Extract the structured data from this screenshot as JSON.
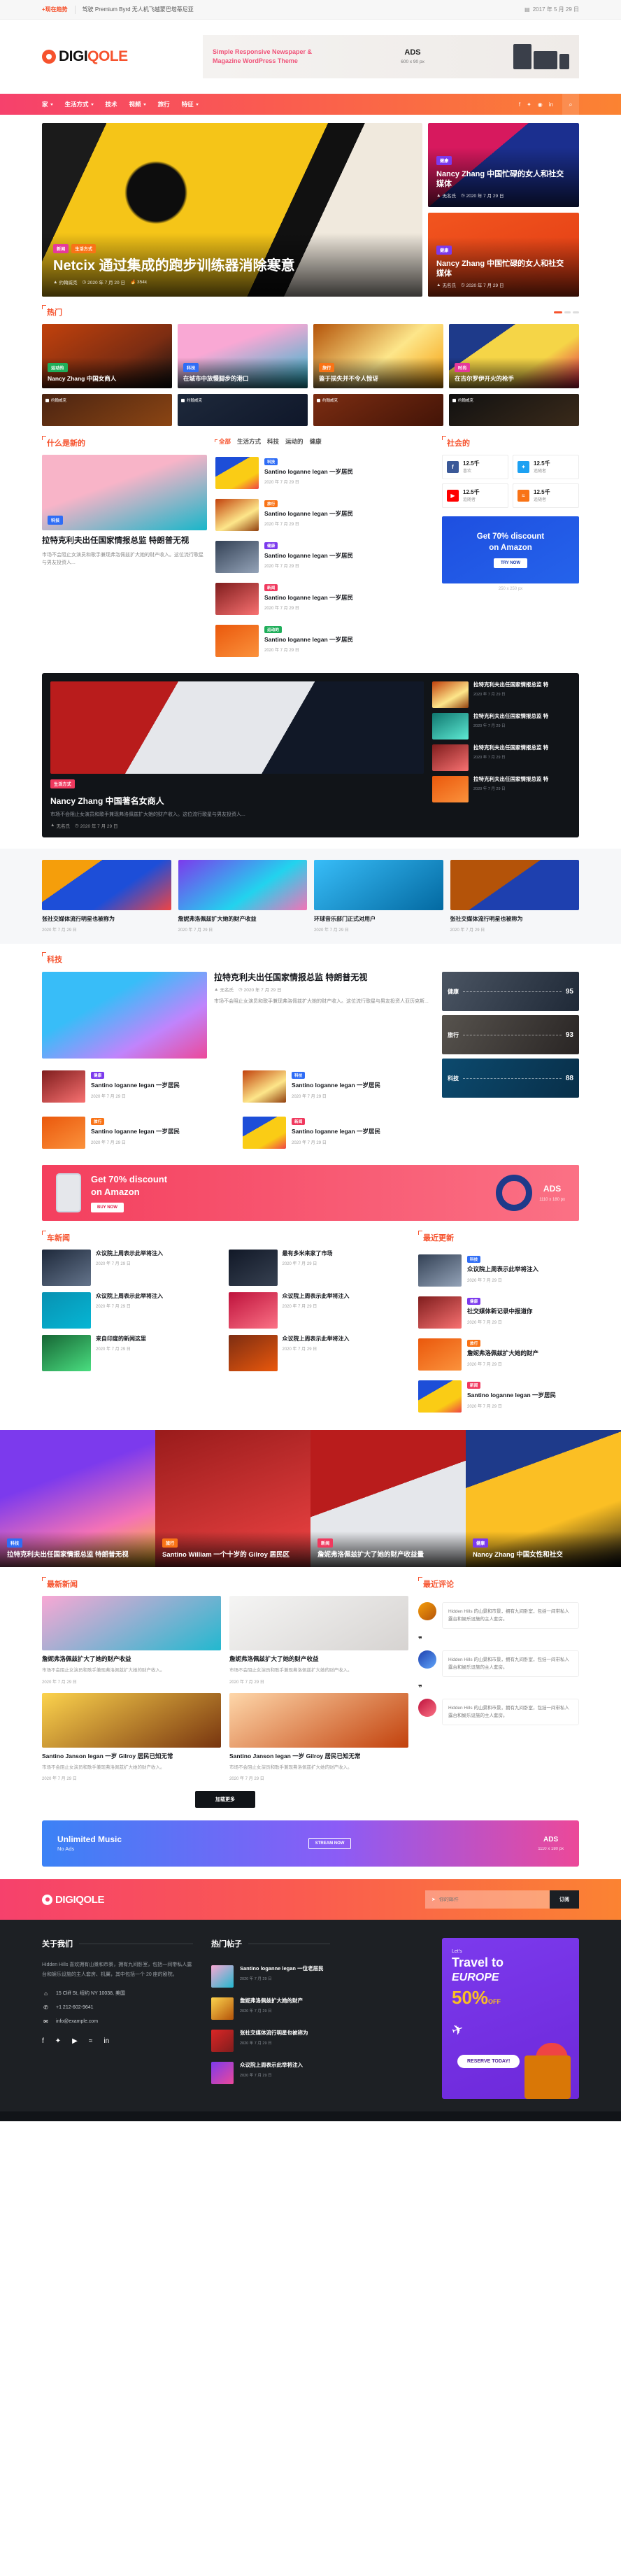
{
  "topbar": {
    "trending_label": "+现在趋势",
    "trending_text": "驾驶 Premium Byrd 无人机飞越蒙巴塔蒂尼亚",
    "date_icon": "calendar-icon",
    "date": "2017 年 5 月 29 日"
  },
  "brand": {
    "name_part1": "DIGI",
    "name_part2": "QOLE",
    "full": "DIGIQOLE"
  },
  "header_ad": {
    "line1": "Simple Responsive Newspaper &",
    "line2": "Magazine WordPress Theme",
    "label": "ADS",
    "size": "600 x 90 px"
  },
  "nav": {
    "items": [
      {
        "label": "家",
        "has_dropdown": true
      },
      {
        "label": "生活方式",
        "has_dropdown": true
      },
      {
        "label": "技术",
        "has_dropdown": false
      },
      {
        "label": "视频",
        "has_dropdown": true
      },
      {
        "label": "旅行",
        "has_dropdown": false
      },
      {
        "label": "特征",
        "has_dropdown": true
      }
    ],
    "social": [
      "facebook-icon",
      "twitter-icon",
      "instagram-icon",
      "linkedin-icon"
    ],
    "search_icon": "search-icon"
  },
  "hero": {
    "main": {
      "cats": [
        {
          "label": "新闻",
          "color": "c-pink"
        },
        {
          "label": "生活方式",
          "color": "c-org"
        }
      ],
      "title": "Netcix 通过集成的跑步训练器消除寒意",
      "author": "约翰威克",
      "date": "2020 年 7 月 20 日",
      "views": "354k"
    },
    "side": [
      {
        "cat": {
          "label": "健康",
          "color": "c-pur"
        },
        "title": "Nancy Zhang 中国忙碌的女人和社交媒体",
        "author": "无名氏",
        "date": "2020 年 7 月 29 日"
      },
      {
        "cat": {
          "label": "健康",
          "color": "c-pur"
        },
        "title": "Nancy Zhang 中国忙碌的女人和社交媒体",
        "author": "无名氏",
        "date": "2020 年 7 月 29 日"
      }
    ]
  },
  "trending": {
    "title": "热门",
    "cards": [
      {
        "cat": {
          "label": "运动的",
          "color": "c-grn"
        },
        "title": "Nancy Zhang 中国女商人"
      },
      {
        "cat": {
          "label": "科技",
          "color": "c-blue"
        },
        "title": "在城市中放慢脚步的港口"
      },
      {
        "cat": {
          "label": "旅行",
          "color": "c-org"
        },
        "title": "鉴于损失并不令人惊讶"
      },
      {
        "cat": {
          "label": "时尚",
          "color": "c-pink"
        },
        "title": "在吉尔罗伊开火的枪手"
      }
    ],
    "minis": [
      {
        "label": "约翰威克"
      },
      {
        "label": "约翰威克"
      },
      {
        "label": "约翰威克"
      },
      {
        "label": "约翰威克"
      }
    ]
  },
  "whatsnew": {
    "title": "什么是新的",
    "feature": {
      "cat": {
        "label": "科技",
        "color": "c-blue"
      },
      "title": "拉特克利夫出任国家情报总监 特朗普无视",
      "excerpt": "市场不会阻止女演员和歌手兼现弗洛佩兹扩大她的财产收入。这位流行歌星与男友投资人..."
    },
    "tabs": [
      "全部",
      "生活方式",
      "科技",
      "运动的",
      "健康"
    ],
    "active_tab": "全部",
    "list": [
      {
        "cat": {
          "label": "科技",
          "color": "c-blue"
        },
        "title": "Santino loganne legan 一岁居民",
        "date": "2020 年 7 月 29 日",
        "thumb": "th-1"
      },
      {
        "cat": {
          "label": "旅行",
          "color": "c-org"
        },
        "title": "Santino loganne legan 一岁居民",
        "date": "2020 年 7 月 29 日",
        "thumb": "th-2"
      },
      {
        "cat": {
          "label": "健康",
          "color": "c-pur"
        },
        "title": "Santino loganne legan 一岁居民",
        "date": "2020 年 7 月 29 日",
        "thumb": "th-3"
      },
      {
        "cat": {
          "label": "新闻",
          "color": "c-red"
        },
        "title": "Santino loganne legan 一岁居民",
        "date": "2020 年 7 月 29 日",
        "thumb": "th-4"
      },
      {
        "cat": {
          "label": "运动的",
          "color": "c-grn"
        },
        "title": "Santino loganne legan 一岁居民",
        "date": "2020 年 7 月 29 日",
        "thumb": "th-6"
      }
    ]
  },
  "social_block": {
    "title": "社会的",
    "items": [
      {
        "icon": "facebook-icon",
        "cls": "s-fb",
        "glyph": "f",
        "count": "12.5千",
        "label": "喜欢"
      },
      {
        "icon": "twitter-icon",
        "cls": "s-tw",
        "glyph": "t",
        "count": "12.5千",
        "label": "追随者"
      },
      {
        "icon": "youtube-icon",
        "cls": "s-yt",
        "glyph": "▶",
        "count": "12.5千",
        "label": "追随者"
      },
      {
        "icon": "rss-icon",
        "cls": "s-rss",
        "glyph": "≈",
        "count": "12.5千",
        "label": "追随者"
      }
    ]
  },
  "sidebar_ad": {
    "line1": "Get 70% discount",
    "line2": "on Amazon",
    "button": "TRY NOW",
    "size": "250 x 250 px"
  },
  "video_block": {
    "feature": {
      "cat": {
        "label": "生活方式",
        "color": "c-red"
      },
      "title": "Nancy Zhang 中国著名女商人",
      "excerpt": "市场不会阻止女演员和歌手兼现弗洛佩兹扩大她的财产收入。这位流行歌星与男友投资人...",
      "author": "无名氏",
      "date": "2020 年 7 月 29 日"
    },
    "list": [
      {
        "title": "拉特克利夫出任国家情报总监 特",
        "date": "2020 年 7 月 29 日",
        "thumb": "th-2"
      },
      {
        "title": "拉特克利夫出任国家情报总监 特",
        "date": "2020 年 7 月 29 日",
        "thumb": "th-5"
      },
      {
        "title": "拉特克利夫出任国家情报总监 特",
        "date": "2020 年 7 月 29 日",
        "thumb": "th-4"
      },
      {
        "title": "拉特克利夫出任国家情报总监 特",
        "date": "2020 年 7 月 29 日",
        "thumb": "th-6"
      }
    ]
  },
  "gray_strip": [
    {
      "img": "gi1",
      "title": "张社交媒体流行明星也被称为",
      "date": "2020 年 7 月 29 日"
    },
    {
      "img": "gi2",
      "title": "詹妮弗洛佩兹扩大她的财产收益",
      "date": "2020 年 7 月 29 日"
    },
    {
      "img": "gi3",
      "title": "环球音乐部门正式对用户",
      "date": "2020 年 7 月 29 日"
    },
    {
      "img": "gi4",
      "title": "张社交媒体流行明星也被称为",
      "date": "2020 年 7 月 29 日"
    }
  ],
  "tech": {
    "title": "科技",
    "feature": {
      "title": "拉特克利夫出任国家情报总监 特朗普无视",
      "author": "无名氏",
      "date": "2020 年 7 月 29 日",
      "excerpt": "市场不会阻止女演员和歌手兼现弗洛佩兹扩大她的财产收入。这位流行歌星与男友投资人亚历克斯..."
    },
    "grid": [
      {
        "cat": {
          "label": "健康",
          "color": "c-pur"
        },
        "title": "Santino loganne legan 一岁居民",
        "date": "2020 年 7 月 29 日",
        "thumb": "th-4"
      },
      {
        "cat": {
          "label": "科技",
          "color": "c-blue"
        },
        "title": "Santino loganne legan 一岁居民",
        "date": "2020 年 7 月 29 日",
        "thumb": "th-2"
      },
      {
        "cat": {
          "label": "旅行",
          "color": "c-org"
        },
        "title": "Santino loganne legan 一岁居民",
        "date": "2020 年 7 月 29 日",
        "thumb": "th-6"
      },
      {
        "cat": {
          "label": "新闻",
          "color": "c-red"
        },
        "title": "Santino loganne legan 一岁居民",
        "date": "2020 年 7 月 29 日",
        "thumb": "th-1"
      }
    ],
    "ranks": [
      {
        "label": "健康",
        "value": "95",
        "cls": "rk1"
      },
      {
        "label": "旅行",
        "value": "93",
        "cls": "rk2"
      },
      {
        "label": "科技",
        "value": "88",
        "cls": "rk3"
      }
    ]
  },
  "wide_ad": {
    "line1": "Get 70% discount",
    "line2": "on Amazon",
    "button": "BUY NOW",
    "label": "ADS",
    "size": "1110 x 180 px"
  },
  "sports": {
    "title": "车新闻",
    "cards": [
      {
        "img": "sp-a",
        "title": "众议院上周表示此举将注入",
        "date": "2020 年 7 月 29 日"
      },
      {
        "img": "sp-b",
        "title": "最有多米来家了市场",
        "date": "2020 年 7 月 29 日"
      },
      {
        "img": "sp-c",
        "title": "众议院上周表示此举将注入",
        "date": "2020 年 7 月 29 日"
      },
      {
        "img": "sp-d",
        "title": "众议院上周表示此举将注入",
        "date": "2020 年 7 月 29 日"
      },
      {
        "img": "sp-e",
        "title": "来自印度的新闻这里",
        "date": "2020 年 7 月 29 日"
      },
      {
        "img": "sp-f",
        "title": "众议院上周表示此举将注入",
        "date": "2020 年 7 月 29 日"
      }
    ]
  },
  "latest_trends": {
    "title": "最近更新",
    "list": [
      {
        "cat": {
          "label": "科技",
          "color": "c-blue"
        },
        "title": "众议院上周表示此举将注入",
        "date": "2020 年 7 月 29 日",
        "thumb": "th-3"
      },
      {
        "cat": {
          "label": "健康",
          "color": "c-pur"
        },
        "title": "社交媒体新记录中报道你",
        "date": "2020 年 7 月 29 日",
        "thumb": "th-4"
      },
      {
        "cat": {
          "label": "旅行",
          "color": "c-org"
        },
        "title": "詹妮弗洛佩兹扩大她的财产",
        "date": "2020 年 7 月 29 日",
        "thumb": "th-6"
      },
      {
        "cat": {
          "label": "新闻",
          "color": "c-red"
        },
        "title": "Santino loganne legan 一岁居民",
        "date": "2020 年 7 月 29 日",
        "thumb": "th-1"
      }
    ]
  },
  "photo_row": [
    {
      "img": "pa",
      "cat": {
        "label": "科技",
        "color": "c-blue"
      },
      "title": "拉特克利夫出任国家情报总监 特朗普无视"
    },
    {
      "img": "pb",
      "cat": {
        "label": "旅行",
        "color": "c-org"
      },
      "title": "Santino William 一个十岁的 Gilroy 居民区"
    },
    {
      "img": "pc",
      "cat": {
        "label": "新闻",
        "color": "c-red"
      },
      "title": "詹妮弗洛佩兹扩大了她的财产收益量"
    },
    {
      "img": "pd",
      "cat": {
        "label": "健康",
        "color": "c-pur"
      },
      "title": "Nancy Zhang 中国女性和社交"
    }
  ],
  "latest_news": {
    "title": "最新新闻",
    "cards": [
      {
        "img": "ni1",
        "title": "詹妮弗洛佩兹扩大了她的财产收益",
        "excerpt": "市场不会阻止女演员和歌手兼现弗洛佩兹扩大她的财产收入。",
        "date": "2020 年 7 月 29 日"
      },
      {
        "img": "ni2",
        "title": "詹妮弗洛佩兹扩大了她的财产收益",
        "excerpt": "市场不会阻止女演员和歌手兼现弗洛佩兹扩大她的财产收入。",
        "date": "2020 年 7 月 29 日"
      },
      {
        "img": "ni3",
        "title": "Santino Janson legan 一岁 Gilroy 居民已知无常",
        "excerpt": "市场不会阻止女演员和歌手兼现弗洛佩兹扩大她的财产收入。",
        "date": "2020 年 7 月 29 日"
      },
      {
        "img": "ni4",
        "title": "Santino Janson legan 一岁 Gilroy 居民已知无常",
        "excerpt": "市场不会阻止女演员和歌手兼现弗洛佩兹扩大她的财产收入。",
        "date": "2020 年 7 月 29 日"
      }
    ],
    "load_more": "加载更多"
  },
  "reviews": {
    "title": "最近评论",
    "items": [
      {
        "av": "av1",
        "text": "Hidden Hills 的山景和市景，拥有九间卧室，包括一间带私人露台和娱乐设施的主人套房。"
      },
      {
        "av": "av2",
        "text": "Hidden Hills 的山景和市景，拥有九间卧室，包括一间带私人露台和娱乐设施的主人套房。"
      },
      {
        "av": "av3",
        "text": "Hidden Hills 的山景和市景，拥有九间卧室，包括一间带私人露台和娱乐设施的主人套房。"
      }
    ]
  },
  "music_ad": {
    "line1": "Unlimited Music",
    "line2": "No Ads",
    "button": "STREAM NOW",
    "label": "ADS",
    "size": "1110 x 180 px"
  },
  "subscribe": {
    "placeholder": "你的邮件",
    "button": "订阅",
    "icon": "send-icon"
  },
  "footer": {
    "about": {
      "title": "关于我们",
      "text": "Hidden Hills 喜欢拥有山景和市景，拥有九间卧室，包括一间带私人露台和娱乐设施的主人套房、机翼，其中包括一个 20 座的剧院。",
      "address": "15 Cliff St, 纽约 NY 10038, 美国",
      "phone": "+1 212-602-9641",
      "email": "info@example.com",
      "socials": [
        "facebook-icon",
        "twitter-icon",
        "youtube-icon",
        "rss-icon",
        "linkedin-icon"
      ]
    },
    "popular": {
      "title": "热门帖子",
      "items": [
        {
          "thumb": "ft1",
          "title": "Santino loganne legan 一位老居民",
          "date": "2020 年 7 月 29 日"
        },
        {
          "thumb": "ft2",
          "title": "詹妮弗洛佩兹扩大她的财产",
          "date": "2020 年 7 月 29 日"
        },
        {
          "thumb": "ft3",
          "title": "张社交媒体流行明星也被称为",
          "date": "2020 年 7 月 29 日"
        },
        {
          "thumb": "ft4",
          "title": "众议院上周表示此举将注入",
          "date": "2020 年 7 月 29 日"
        }
      ]
    },
    "travel_ad": {
      "lets": "Let's",
      "travel": "Travel to",
      "europe": "EUROPE",
      "off": "50%",
      "off_suffix": "OFF",
      "cta": "RESERVE TODAY!"
    }
  }
}
